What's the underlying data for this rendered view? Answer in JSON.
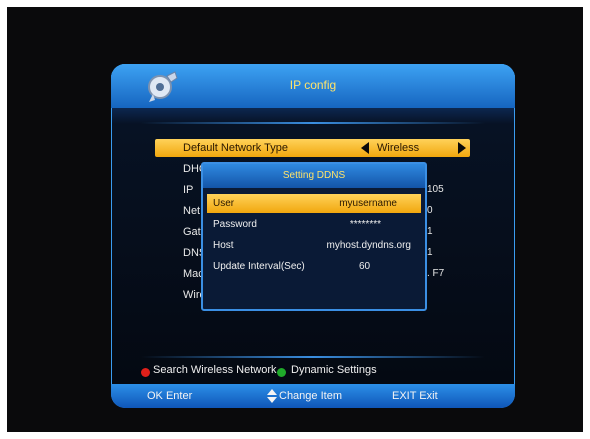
{
  "title": "IP config",
  "network_type": {
    "label": "Default Network Type",
    "value": "Wireless"
  },
  "bg_rows": [
    {
      "label": "DHC"
    },
    {
      "label": "IP",
      "value": "105"
    },
    {
      "label": "Net",
      "value": "0"
    },
    {
      "label": "Gat",
      "value": "1"
    },
    {
      "label": "DNS",
      "value": "1"
    },
    {
      "label": "Mac",
      "value": ". F7"
    },
    {
      "label": "Wire",
      "value": ""
    }
  ],
  "dialog": {
    "title": "Setting DDNS",
    "rows": [
      {
        "key": "User",
        "value": "myusername"
      },
      {
        "key": "Password",
        "value": "********"
      },
      {
        "key": "Host",
        "value": "myhost.dyndns.org"
      },
      {
        "key": "Update Interval(Sec)",
        "value": "60"
      }
    ]
  },
  "hints": {
    "red": "Search Wireless Network",
    "green": "Dynamic Settings"
  },
  "bottom_bar": {
    "ok": "OK Enter",
    "change": "Change Item",
    "exit": "EXIT Exit"
  },
  "colors": {
    "highlight": "#f1a70e",
    "title_text": "#ffe46a",
    "red_button": "#e0201a",
    "green_button": "#1faa2a"
  }
}
